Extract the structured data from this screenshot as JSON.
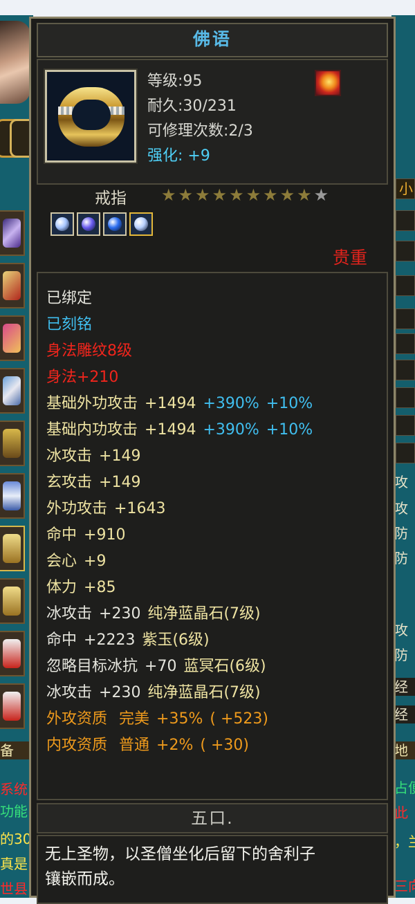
{
  "tooltip": {
    "title": "佛语",
    "stats": {
      "level": "等级:95",
      "durability": "耐久:30/231",
      "repairs": "可修理次数:2/3",
      "enhance": "强化: +9"
    },
    "item_type": "戒指",
    "stars": {
      "filled": 9,
      "total": 10
    },
    "gems": [
      {
        "icon": "ice-gem-icon",
        "color": "#a7c6ff"
      },
      {
        "icon": "purple-gem-icon",
        "color": "#6a5cf0"
      },
      {
        "icon": "blue-gem-icon",
        "color": "#2c6ef0"
      },
      {
        "icon": "ice-gem-icon",
        "color": "#b8d0ff"
      }
    ],
    "rarity": "贵重",
    "attributes": {
      "bound": "已绑定",
      "engraved": "已刻铭",
      "carving": "身法雕纹8级",
      "agility": "身法+210",
      "base_ext_atk": {
        "label": "基础外功攻击",
        "value": "+1494",
        "pct": "+390%",
        "pct2": "+10%"
      },
      "base_int_atk": {
        "label": "基础内功攻击",
        "value": "+1494",
        "pct": "+390%",
        "pct2": "+10%"
      },
      "ice_atk": {
        "label": "冰攻击",
        "value": "+149"
      },
      "xuan_atk": {
        "label": "玄攻击",
        "value": "+149"
      },
      "ext_atk": {
        "label": "外功攻击",
        "value": "+1643"
      },
      "hit": {
        "label": "命中",
        "value": "+910"
      },
      "crit": {
        "label": "会心",
        "value": "+9"
      },
      "stamina": {
        "label": "体力",
        "value": "+85"
      },
      "gem_line_1": {
        "label": "冰攻击",
        "value": "+230",
        "gem": "纯净蓝晶石(7级)"
      },
      "gem_line_2": {
        "label": "命中",
        "value": "+2223",
        "gem": "紫玉(6级)"
      },
      "gem_line_3": {
        "label": "忽略目标冰抗",
        "value": "+70",
        "gem": "蓝冥石(6级)"
      },
      "gem_line_4": {
        "label": "冰攻击",
        "value": "+230",
        "gem": "纯净蓝晶石(7级)"
      },
      "qual_ext": {
        "label": "外攻资质",
        "grade": "完美",
        "value": "+35%",
        "extra": "( +523)"
      },
      "qual_int": {
        "label": "内攻资质",
        "grade": "普通",
        "value": "+2%",
        "extra": "( +30)"
      }
    },
    "footer": "五口.",
    "description_line1": "无上圣物，以圣僧坐化后留下的舍利子",
    "description_line2": "镶嵌而成。"
  },
  "background": {
    "left_texts": [
      "备",
      "系统",
      "功能",
      "的30",
      "真是",
      "世县"
    ],
    "right_texts": [
      "小",
      "攻",
      "攻",
      "防",
      "防",
      "攻",
      "防",
      "经",
      "经",
      "地",
      "占便",
      "此",
      "，兰",
      "三向"
    ]
  }
}
